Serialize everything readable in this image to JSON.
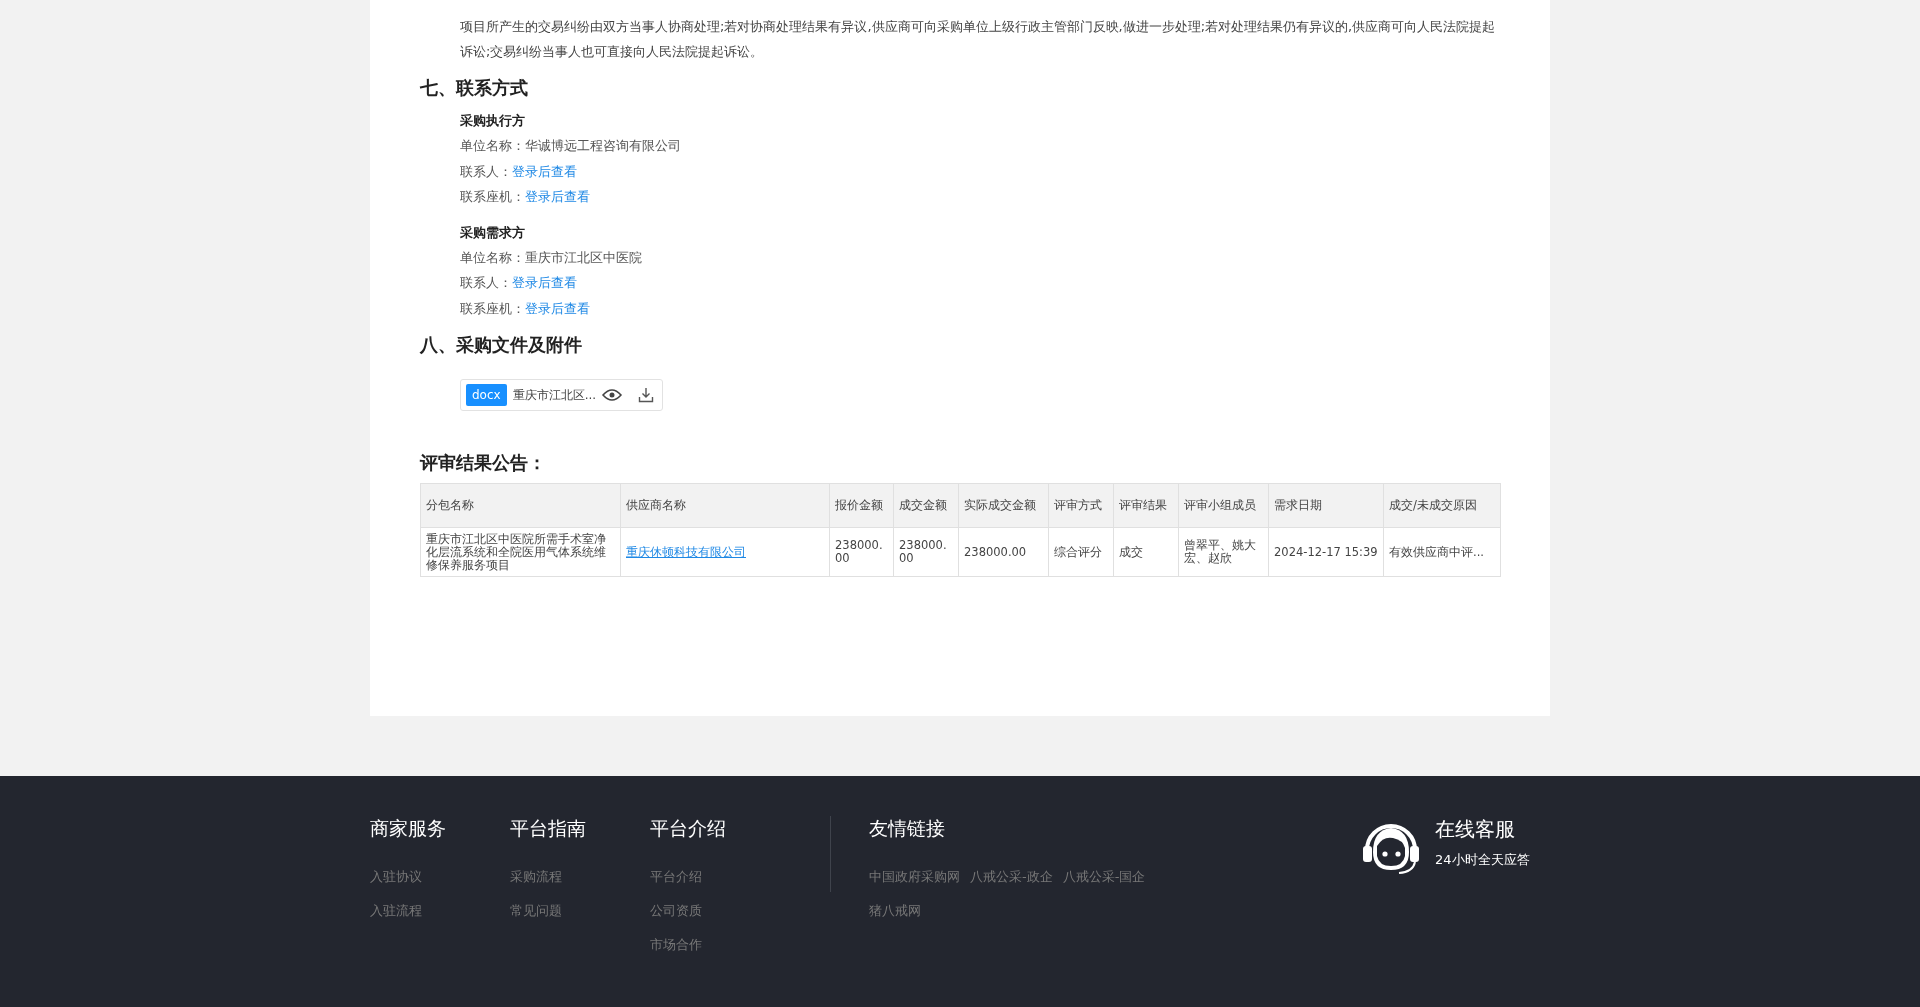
{
  "dispute_text": "项目所产生的交易纠纷由双方当事人协商处理;若对协商处理结果有异议,供应商可向采购单位上级行政主管部门反映,做进一步处理;若对处理结果仍有异议的,供应商可向人民法院提起诉讼;交易纠纷当事人也可直接向人民法院提起诉讼。",
  "contact": {
    "heading": "七、联系方式",
    "groups": [
      {
        "title": "采购执行方",
        "rows": [
          {
            "label": "单位名称：",
            "value": "华诚博远工程咨询有限公司",
            "kind": "text"
          },
          {
            "label": "联系人：",
            "value": "登录后查看",
            "kind": "link"
          },
          {
            "label": "联系座机：",
            "value": "登录后查看",
            "kind": "link"
          }
        ]
      },
      {
        "title": "采购需求方",
        "rows": [
          {
            "label": "单位名称：",
            "value": "重庆市江北区中医院",
            "kind": "text"
          },
          {
            "label": "联系人：",
            "value": "登录后查看",
            "kind": "link"
          },
          {
            "label": "联系座机：",
            "value": "登录后查看",
            "kind": "link"
          }
        ]
      }
    ]
  },
  "attachments": {
    "heading": "八、采购文件及附件",
    "files": [
      {
        "type": "docx",
        "name": "重庆市江北区..."
      }
    ]
  },
  "result": {
    "heading": "评审结果公告：",
    "columns": [
      "分包名称",
      "供应商名称",
      "报价金额",
      "成交金额",
      "实际成交金额",
      "评审方式",
      "评审结果",
      "评审小组成员",
      "需求日期",
      "成交/未成交原因"
    ],
    "rows": [
      {
        "cells": [
          {
            "text": "重庆市江北区中医院所需手术室净化层流系统和全院医用气体系统维修保养服务项目",
            "kind": "text"
          },
          {
            "text": "重庆休顿科技有限公司",
            "kind": "link"
          },
          {
            "text": "238000.00",
            "kind": "text"
          },
          {
            "text": "238000.00",
            "kind": "text"
          },
          {
            "text": "238000.00",
            "kind": "text"
          },
          {
            "text": "综合评分",
            "kind": "text"
          },
          {
            "text": "成交",
            "kind": "text"
          },
          {
            "text": "曾翠平、姚大宏、赵欣",
            "kind": "text"
          },
          {
            "text": "2024-12-17 15:39",
            "kind": "text"
          },
          {
            "text": "有效供应商中评...",
            "kind": "text"
          }
        ]
      }
    ]
  },
  "footer": {
    "columns": [
      {
        "title": "商家服务",
        "links": [
          "入驻协议",
          "入驻流程"
        ]
      },
      {
        "title": "平台指南",
        "links": [
          "采购流程",
          "常见问题"
        ]
      },
      {
        "title": "平台介绍",
        "links": [
          "平台介绍",
          "公司资质",
          "市场合作"
        ]
      }
    ],
    "friend_links": {
      "title": "友情链接",
      "links": [
        "中国政府采购网",
        "八戒公采-政企",
        "八戒公采-国企",
        "猪八戒网"
      ]
    },
    "service": {
      "title": "在线客服",
      "subtitle": "24小时全天应答"
    }
  }
}
